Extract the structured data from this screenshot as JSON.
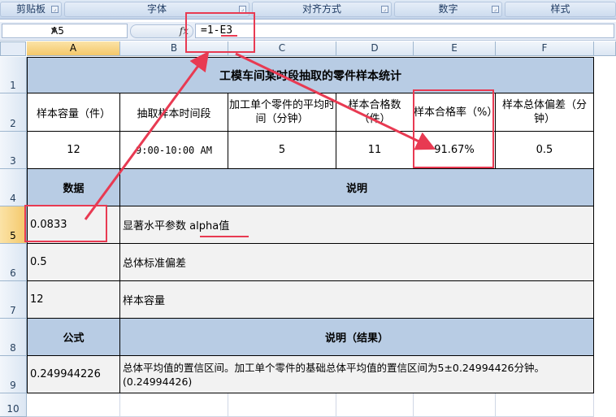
{
  "ribbon": {
    "groups": [
      "剪贴板",
      "字体",
      "对齐方式",
      "数字",
      "样式"
    ]
  },
  "formula_bar": {
    "name_box": "A5",
    "fx_label": "fx",
    "formula": "=1-E3"
  },
  "columns": [
    "A",
    "B",
    "C",
    "D",
    "E",
    "F"
  ],
  "rows": [
    "1",
    "2",
    "3",
    "4",
    "5",
    "6",
    "7",
    "8",
    "9",
    "10"
  ],
  "sheet": {
    "title": "工模车间某时段抽取的零件样本统计",
    "header_row": [
      "样本容量（件）",
      "抽取样本时间段",
      "加工单个零件的平均时间（分钟）",
      "样本合格数（件）",
      "样本合格率（%）",
      "样本总体偏差（分钟）"
    ],
    "value_row": [
      "12",
      "9:00-10:00 AM",
      "5",
      "11",
      "91.67%",
      "0.5"
    ],
    "data_header": "数据",
    "desc_header": "说明",
    "data_rows": [
      {
        "value": "0.0833",
        "desc_prefix": "显著水平参数 ",
        "desc_term": "alpha值"
      },
      {
        "value": "0.5",
        "desc_prefix": "总体标准偏差",
        "desc_term": ""
      },
      {
        "value": "12",
        "desc_prefix": "样本容量",
        "desc_term": ""
      }
    ],
    "formula_header": "公式",
    "result_header": "说明（结果）",
    "result_value": "0.249944226",
    "result_desc": "总体平均值的置信区间。加工单个零件的基础总体平均值的置信区间为5±0.24994426分钟。(0.24994426)"
  },
  "annotation_color": "#e83a52"
}
